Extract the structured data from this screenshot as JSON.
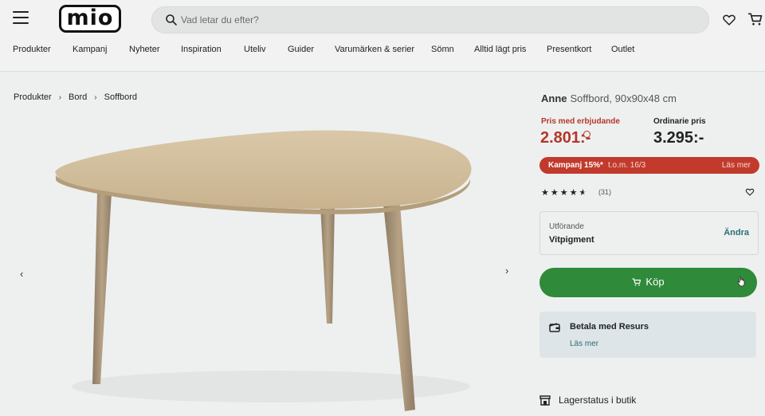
{
  "header": {
    "logo": "mio",
    "search_placeholder": "Vad letar du efter?"
  },
  "nav": {
    "items": [
      "Produkter",
      "Kampanj",
      "Nyheter",
      "Inspiration",
      "Uteliv",
      "Guider",
      "Varumärken & serier",
      "Sömn",
      "Alltid lägt pris",
      "Presentkort",
      "Outlet"
    ]
  },
  "breadcrumb": [
    "Produkter",
    "Bord",
    "Soffbord"
  ],
  "product": {
    "brand": "Anne",
    "description": "Soffbord, 90x90x48 cm",
    "offer_label": "Pris med erbjudande",
    "offer_price": "2.801:-",
    "regular_label": "Ordinarie pris",
    "regular_price": "3.295:-",
    "campaign_label": "Kampanj 15%*",
    "campaign_date": "t.o.m. 16/3",
    "campaign_more": "Läs mer",
    "rating": 4.5,
    "review_count": "(31)",
    "variant_label": "Utförande",
    "variant_value": "Vitpigment",
    "variant_change": "Ändra",
    "buy_label": "Köp",
    "resurs_title": "Betala med Resurs",
    "resurs_link": "Läs mer",
    "stock_label": "Lagerstatus i butik"
  },
  "colors": {
    "offer_red": "#b3362b",
    "campaign_bg": "#c23a2c",
    "buy_green": "#2f8a3a",
    "link_teal": "#2a6f74"
  }
}
